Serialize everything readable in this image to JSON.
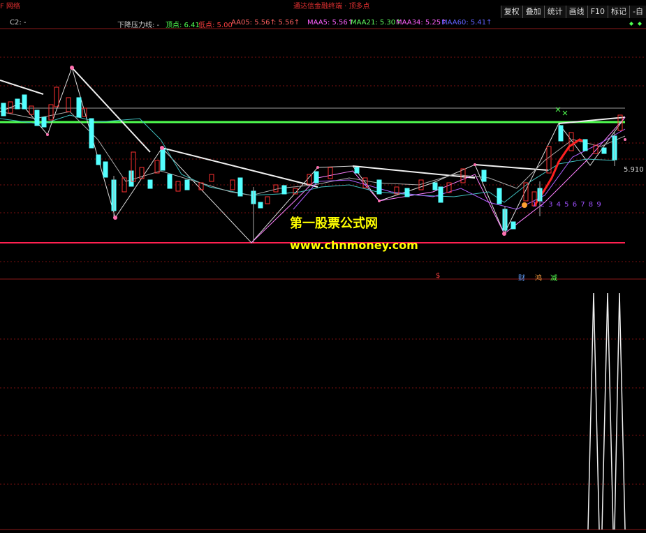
{
  "header": {
    "left_tab": "F 网络",
    "title": "通达信金融终端 · 顶多点"
  },
  "toolbar": {
    "items": [
      "复权",
      "叠加",
      "统计",
      "画线",
      "F10",
      "标记",
      "-自"
    ]
  },
  "legend": {
    "c2": "C2: -",
    "pressure_line": "下降压力线: -",
    "top_point": "顶点: 6.41",
    "low_point": "低点: 5.00",
    "aa05": "AA05: 5.56↑",
    "aa05_b": ": 5.56↑",
    "maa5": "MAA5: 5.56↑",
    "maa21": "MAA21: 5.30↑",
    "maa34": "MAA34: 5.25↑",
    "maa60": "MAA60: 5.41↑",
    "dots": "◆ ◆"
  },
  "price_label": "5.910",
  "sequence": "1 2 3 4 5 6 7 8 9",
  "tags": {
    "s": "$",
    "cai": "财",
    "hong": "鸿",
    "jian": "减"
  },
  "watermark": {
    "line1": "第一股票公式网",
    "line2": "www.chnmoney.com"
  },
  "chart_data": {
    "type": "candlestick",
    "levels": {
      "top_point": 6.41,
      "low_point": 5.0
    },
    "colors": {
      "up": "#ff3030",
      "down": "#54ffff",
      "support_line": "#ff2050",
      "resistance_line": "#50ff50"
    }
  }
}
